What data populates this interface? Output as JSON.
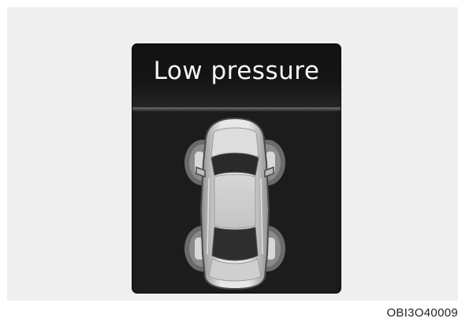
{
  "display": {
    "title": "Low pressure",
    "icon": "car-top-view-tire-pressure-icon",
    "warning_tires": [
      "front-left",
      "front-right",
      "rear-left",
      "rear-right"
    ]
  },
  "figure": {
    "caption": "OBI3O40009"
  },
  "colors": {
    "display_background": "#1c1c1c",
    "title_text": "#f5f5f5",
    "tire_highlight": "#bdbdbd"
  }
}
